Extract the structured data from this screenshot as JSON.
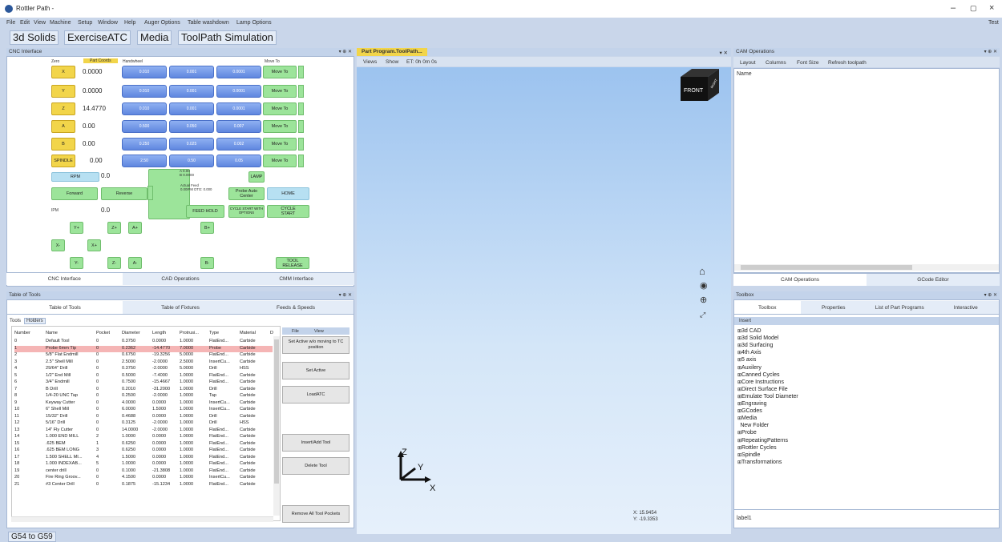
{
  "window": {
    "title": "Rottler Path -",
    "user": "Test"
  },
  "menu": [
    "File",
    "Edit",
    "View",
    "Machine",
    "Setup",
    "Window",
    "Help",
    "Auger Options",
    "Table washdown",
    "Lamp Options"
  ],
  "main_tabs": [
    "3d Solids",
    "ExerciseATC",
    "Media",
    "ToolPath Simulation"
  ],
  "cnc": {
    "panel_title": "CNC Interface",
    "head": {
      "zero": "Zero",
      "part_coords": "Part Coords",
      "handwheel": "Handwheel",
      "move_to": "Move To"
    },
    "axes": [
      {
        "label": "X",
        "value": "0.0000",
        "inc": [
          "0.010",
          "0.001",
          "0.0001"
        ],
        "move": "Move To"
      },
      {
        "label": "Y",
        "value": "0.0000",
        "inc": [
          "0.010",
          "0.001",
          "0.0001"
        ],
        "move": "Move To"
      },
      {
        "label": "Z",
        "value": "14.4770",
        "inc": [
          "0.010",
          "0.001",
          "0.0001"
        ],
        "move": "Move To"
      },
      {
        "label": "A",
        "value": "0.00",
        "inc": [
          "0.500",
          "0.050",
          "0.007"
        ],
        "move": "Move To"
      },
      {
        "label": "B",
        "value": "0.00",
        "inc": [
          "0.250",
          "0.025",
          "0.002"
        ],
        "move": "Move To"
      },
      {
        "label": "SPINDLE",
        "value": "0.00",
        "inc": [
          "2.50",
          "0.50",
          "0.05"
        ],
        "move": "Move To"
      }
    ],
    "rpm": {
      "label": "RPM",
      "value": "0.0"
    },
    "ipm": {
      "label": "IPM",
      "value": "0.0"
    },
    "info_a": "A 0.00",
    "info_b": "B 0.0000",
    "info_feed": "Actual Feed 0.00IPM DTG: 0.000",
    "lamp": "LAMP",
    "forward": "Forward",
    "reverse": "Reverse",
    "probe_auto_center": "Probe Auto Center",
    "home": "HOME",
    "feed_hold": "FEED HOLD",
    "cycle_start_options": "CYCLE START WITH OPTIONS",
    "cycle_start": "CYCLE START",
    "jog": {
      "yp": "Y+",
      "zp": "Z+",
      "ap": "A+",
      "bp": "B+",
      "xm": "X-",
      "xp": "X+",
      "ym": "Y-",
      "zm": "Z-",
      "am": "A-",
      "bm": "B-"
    },
    "tool_release": "TOOL RELEASE",
    "strip_comp": "COMP",
    "strip_limit": "LIMIT",
    "bottom_tabs": [
      "CNC Interface",
      "CAD Operations",
      "CMM Interface"
    ]
  },
  "tools": {
    "panel_title": "Table of Tools",
    "tabs": [
      "Table of Tools",
      "Table of Fixtures",
      "Feeds & Speeds"
    ],
    "subtabs": [
      "Tools",
      "Holders"
    ],
    "columns": [
      "Number",
      "Name",
      "Pocket",
      "Diameter",
      "Length",
      "Protrusi...",
      "Type",
      "Material",
      "D"
    ],
    "rows": [
      [
        "0",
        "Default Tool",
        "0",
        "0.3750",
        "0.0000",
        "1.0000",
        "FlatEnd...",
        "Carbide"
      ],
      [
        "1",
        "Probe 6mm Tip",
        "0",
        "0.2362",
        "-14.4770",
        "7.0000",
        "Probe",
        "Carbide"
      ],
      [
        "2",
        "5/8\" Flat Endmill",
        "0",
        "0.6750",
        "-19.3256",
        "5.0000",
        "FlatEnd...",
        "Carbide"
      ],
      [
        "3",
        "2.5\" Shell Mill",
        "0",
        "2.5000",
        "-2.0000",
        "2.5000",
        "InsertCu...",
        "Carbide"
      ],
      [
        "4",
        "29/64\" Drill",
        "0",
        "0.3750",
        "-2.0000",
        "5.0000",
        "Drill",
        "HSS"
      ],
      [
        "5",
        "1/2\" End Mill",
        "0",
        "0.5000",
        "-7.4000",
        "1.0000",
        "FlatEnd...",
        "Carbide"
      ],
      [
        "6",
        "3/4\" Endmill",
        "0",
        "0.7500",
        "-15.4667",
        "1.0000",
        "FlatEnd...",
        "Carbide"
      ],
      [
        "7",
        "B Drill",
        "0",
        "0.2010",
        "-31.2000",
        "1.0000",
        "Drill",
        "Carbide"
      ],
      [
        "8",
        "1/4-20 UNC Tap",
        "0",
        "0.2500",
        "-2.0000",
        "1.0000",
        "Tap",
        "Carbide"
      ],
      [
        "9",
        "Keyway Cutter",
        "0",
        "4.0000",
        "0.0000",
        "1.0000",
        "InsertCu...",
        "Carbide"
      ],
      [
        "10",
        "6\" Shell Mill",
        "0",
        "6.0000",
        "1.5000",
        "1.0000",
        "InsertCu...",
        "Carbide"
      ],
      [
        "11",
        "15/32\" Drill",
        "0",
        "0.4688",
        "0.0000",
        "1.0000",
        "Drill",
        "Carbide"
      ],
      [
        "12",
        "5/16\" Drill",
        "0",
        "0.3125",
        "-2.0000",
        "1.0000",
        "Drill",
        "HSS"
      ],
      [
        "13",
        "14\" Fly Cutter",
        "0",
        "14.0000",
        "-2.0000",
        "1.0000",
        "FlatEnd...",
        "Carbide"
      ],
      [
        "14",
        "1.000 END MILL",
        "2",
        "1.0000",
        "0.0000",
        "1.0000",
        "FlatEnd...",
        "Carbide"
      ],
      [
        "15",
        ".625 BEM",
        "1",
        "0.6250",
        "0.0000",
        "1.0000",
        "FlatEnd...",
        "Carbide"
      ],
      [
        "16",
        ".625 BEM LONG",
        "3",
        "0.6250",
        "0.0000",
        "1.0000",
        "FlatEnd...",
        "Carbide"
      ],
      [
        "17",
        "1.500 SHELL MI...",
        "4",
        "1.5000",
        "0.0000",
        "1.0000",
        "FlatEnd...",
        "Carbide"
      ],
      [
        "18",
        "1.000 INDEXAB...",
        "5",
        "1.0000",
        "0.0000",
        "1.0000",
        "FlatEnd...",
        "Carbide"
      ],
      [
        "19",
        "center drill",
        "0",
        "0.1000",
        "-21.3808",
        "1.0000",
        "FlatEnd...",
        "Carbide"
      ],
      [
        "20",
        "Fire Ring Groov...",
        "0",
        "4.1500",
        "0.0000",
        "1.0000",
        "InsertCu...",
        "Carbide"
      ],
      [
        "21",
        "#3 Center Drill",
        "0",
        "0.1875",
        "-15.1234",
        "1.0000",
        "FlatEnd...",
        "Carbide"
      ]
    ],
    "side_menu": [
      "File",
      "View"
    ],
    "actions": [
      "Set Active w/o moving to TC position",
      "Set Active",
      "LoadATC",
      "Insert/Add Tool",
      "Delete Tool",
      "Remove All Tool Pockets"
    ]
  },
  "viewport": {
    "tab": "Part Program.ToolPath...",
    "toolbar": [
      "Views",
      "Show",
      "ET: 0h 0m 0s"
    ],
    "cube_front": "FRONT",
    "cube_right": "RIGHT",
    "axis_x": "X",
    "axis_y": "Y",
    "axis_z": "Z",
    "coord_x": "X: 15.9454",
    "coord_y": "Y: -19.3353"
  },
  "cam": {
    "panel_title": "CAM Operations",
    "toolbar": [
      "Layout",
      "Columns",
      "Font Size",
      "Refresh toolpath"
    ],
    "name_col": "Name",
    "bottom_tabs": [
      "CAM Operations",
      "GCode Editor"
    ]
  },
  "toolbox": {
    "panel_title": "Toolbox",
    "tabs": [
      "Toolbox",
      "Properties",
      "List of Part Programs",
      "Interactive"
    ],
    "insert": "Insert",
    "items": [
      "3d CAD",
      "3d Solid Model",
      "3d Surfacing",
      "4th Axis",
      "5 axis",
      "Auxilery",
      "Canned Cycles",
      "Core Instructions",
      "Direct Surface File",
      "Emulate Tool Diameter",
      "Engraving",
      "GCodes",
      "Media",
      "New Folder",
      "Probe",
      "RepeatingPatterns",
      "Rottler Cycles",
      "Spindle",
      "Transformations"
    ],
    "label1": "label1"
  },
  "footer": {
    "button": "G54 to G59"
  }
}
